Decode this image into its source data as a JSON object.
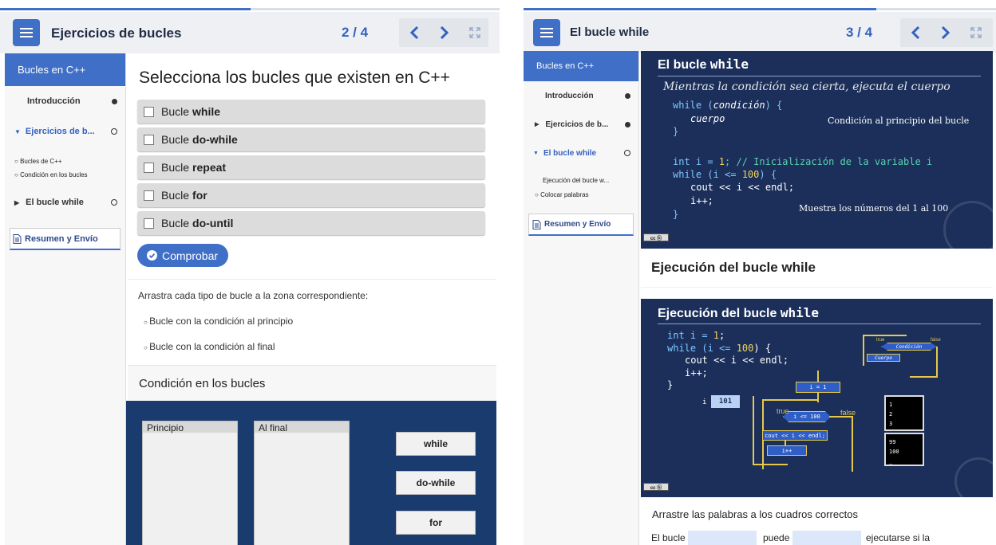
{
  "left": {
    "title": "Ejercicios de bucles",
    "page": "2 / 4",
    "sidebar": {
      "top": "Bucles en C++",
      "items": [
        {
          "label": "Introducción"
        },
        {
          "label": "Ejercicios de b..."
        },
        {
          "label": "El bucle while"
        }
      ],
      "sub": [
        "Bucles de C++",
        "Condición en los bucles"
      ],
      "resumen": "Resumen y Envío"
    },
    "question": "Selecciona los bucles que existen en C++",
    "options": [
      {
        "prefix": "Bucle",
        "bold": "while"
      },
      {
        "prefix": "Bucle",
        "bold": "do-while"
      },
      {
        "prefix": "Bucle",
        "bold": "repeat"
      },
      {
        "prefix": "Bucle",
        "bold": "for"
      },
      {
        "prefix": "Bucle",
        "bold": "do-until"
      }
    ],
    "check_button": "Comprobar",
    "drag_instruction": "Arrastra cada tipo de bucle a la zona correspondiente:",
    "bullets": [
      "Bucle con la condición al principio",
      "Bucle con la condición al final"
    ],
    "section_title": "Condición en los bucles",
    "drop_columns": [
      "Principio",
      "Al final"
    ],
    "chips": [
      "while",
      "do-while",
      "for"
    ]
  },
  "right": {
    "title": "El bucle while",
    "page": "3 / 4",
    "sidebar": {
      "top": "Bucles en C++",
      "items": [
        {
          "label": "Introducción"
        },
        {
          "label": "Ejercicios de b..."
        },
        {
          "label": "El bucle while"
        }
      ],
      "sub": [
        "Ejecución del bucle w...",
        "Colocar palabras"
      ],
      "resumen": "Resumen y Envío"
    },
    "slide1": {
      "title_prefix": "El bucle ",
      "title_code": "while",
      "subtitle": "Mientras la condición sea cierta, ejecuta el cuerpo",
      "code1": [
        "while (",
        "condición",
        ") {",
        "cuerpo",
        "}"
      ],
      "note1": "Condición al principio del bucle",
      "code2": {
        "l1a": "int i = ",
        "l1b": "1",
        "l1c": "; // Inicialización de la variable i",
        "l2a": "while (i <= ",
        "l2b": "100",
        "l2c": ") {",
        "l3": "cout << i << endl;",
        "l4": "i++;",
        "l5": "}"
      },
      "note2": "Muestra los números del 1 al 100"
    },
    "heading": "Ejecución del bucle while",
    "slide2": {
      "title_prefix": "Ejecución del bucle ",
      "title_code": "while",
      "code": {
        "l1a": "int i = ",
        "l1b": "1",
        "l1c": ";",
        "l2a": "while (i <= ",
        "l2b": "100",
        "l2c": ") {",
        "l3": "cout << i << endl;",
        "l4": "i++;",
        "l5": "}"
      },
      "var_name": "i",
      "var_value": "101",
      "flow": {
        "init": "i = 1",
        "cond": "i <= 100",
        "body": "cout << i << endl;",
        "inc": "i++",
        "true": "true",
        "false": "false",
        "mini_cond": "Condición",
        "mini_body": "Cuerpo"
      },
      "term_top": [
        "1",
        "2",
        "3"
      ],
      "term_bottom": [
        "99",
        "100",
        "_"
      ]
    },
    "drag_instruction": "Arrastre las palabras a los cuadros correctos",
    "sentence": [
      "El bucle",
      "puede",
      "ejecutarse si la"
    ]
  },
  "colors": {
    "accent": "#3f6fc7",
    "page_number": "#3461c0",
    "dark_panel": "#193b6d",
    "slide_bg": "#1b2f5a"
  },
  "icons": [
    "hamburger-menu-icon",
    "chevron-left-icon",
    "chevron-right-icon",
    "fullscreen-icon",
    "checkbox-icon",
    "check-circle-icon",
    "document-icon",
    "caret-right-icon",
    "caret-down-icon"
  ]
}
